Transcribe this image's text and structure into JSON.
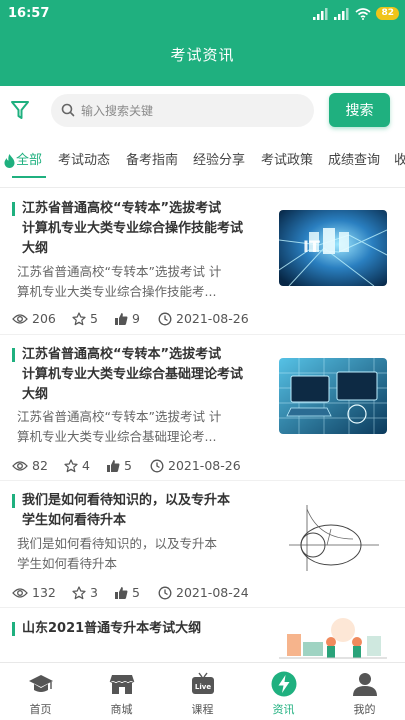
{
  "status": {
    "time": "16:57",
    "battery": "82"
  },
  "header": {
    "title": "考试资讯"
  },
  "search": {
    "placeholder": "输入搜索关键",
    "button_label": "搜索"
  },
  "categories": [
    "全部",
    "考试动态",
    "备考指南",
    "经验分享",
    "考试政策",
    "成绩查询",
    "收"
  ],
  "active_category": "全部",
  "articles": [
    {
      "title_lines": [
        "江苏省普通高校“专转本”选拔考试",
        "计算机专业大类专业综合操作技能考试",
        "大纲"
      ],
      "summary_lines": [
        "江苏省普通高校“专转本”选拔考试 计",
        "算机专业大类专业综合操作技能考..."
      ],
      "views": "206",
      "favorites": "5",
      "likes": "9",
      "date": "2021-08-26",
      "thumbnail": "blue-circuit-image"
    },
    {
      "title_lines": [
        "江苏省普通高校“专转本”选拔考试",
        "计算机专业大类专业综合基础理论考试",
        "大纲"
      ],
      "summary_lines": [
        "江苏省普通高校“专转本”选拔考试 计",
        "算机专业大类专业综合基础理论考..."
      ],
      "views": "82",
      "favorites": "4",
      "likes": "5",
      "date": "2021-08-26",
      "thumbnail": "computer-tech-image"
    },
    {
      "title_lines": [
        "我们是如何看待知识的，以及专升本",
        "学生如何看待升本"
      ],
      "summary_lines": [
        "我们是如何看待知识的，以及专升本",
        "学生如何看待升本"
      ],
      "views": "132",
      "favorites": "3",
      "likes": "5",
      "date": "2021-08-24",
      "thumbnail": "math-graph-image"
    },
    {
      "title_lines": [
        "山东2021普通专升本考试大纲"
      ],
      "thumbnail": "office-illustration-image"
    }
  ],
  "tabbar": [
    {
      "label": "首页",
      "icon": "graduation-cap-icon"
    },
    {
      "label": "商城",
      "icon": "shop-icon"
    },
    {
      "label": "课程",
      "icon": "live-tv-icon",
      "badge": "Live"
    },
    {
      "label": "资讯",
      "icon": "lightning-icon",
      "active": true
    },
    {
      "label": "我的",
      "icon": "user-icon"
    }
  ],
  "colors": {
    "accent": "#1fb07f",
    "battery": "#f0c419"
  }
}
